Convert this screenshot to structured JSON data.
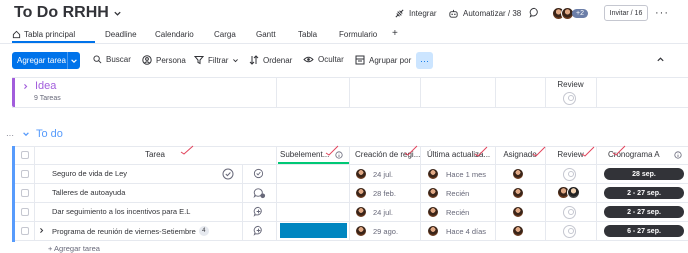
{
  "header": {
    "title": "To Do RRHH",
    "integrate": "Integrar",
    "automate": "Automatizar / 38",
    "members_extra": "+2",
    "invite": "Invitar / 16"
  },
  "tabs": [
    "Tabla principal",
    "Deadline",
    "Calendario",
    "Carga",
    "Gantt",
    "Tabla",
    "Formulario",
    "+"
  ],
  "toolbar": {
    "add_task": "Agregar tarea",
    "search": "Buscar",
    "person": "Persona",
    "filter": "Filtrar",
    "sort": "Ordenar",
    "hide": "Ocultar",
    "group_by": "Agrupar por"
  },
  "groups": {
    "idea": {
      "title": "Idea",
      "count": "9 Tareas",
      "review_header": "Review",
      "color": "#a25ddc"
    },
    "todo": {
      "title": "To do",
      "color": "#579bfc"
    }
  },
  "columns": {
    "task": "Tarea",
    "subitems": "Subelement...",
    "created": "Creación de regi...",
    "updated": "Última actualiza...",
    "assigned": "Asignado",
    "review": "Review",
    "timeline": "Cronograma A"
  },
  "rows": [
    {
      "name": "Seguro de vida de Ley",
      "created": "24 jul.",
      "updated": "Hace 1 mes",
      "timeline": "28 sep.",
      "sub_count": "",
      "subitem_bar": false
    },
    {
      "name": "Talleres de autoayuda",
      "created": "28 feb.",
      "updated": "Recién",
      "timeline": "2 - 27 sep.",
      "sub_count": "",
      "subitem_bar": false
    },
    {
      "name": "Dar seguimiento a los incentivos para E.L",
      "created": "24 jul.",
      "updated": "Recién",
      "timeline": "2 - 27 sep.",
      "sub_count": "",
      "subitem_bar": false
    },
    {
      "name": "Programa de reunión de viernes-Setiembre",
      "created": "29 ago.",
      "updated": "Hace 4 días",
      "timeline": "6 - 27 sep.",
      "sub_count": "4",
      "subitem_bar": true
    }
  ],
  "add_task_row": "+ Agregar tarea",
  "colors": {
    "primary": "#0073ea",
    "timeline": "#323338",
    "subitem_bar": "#0086c0",
    "annotation": "#e2445c"
  }
}
